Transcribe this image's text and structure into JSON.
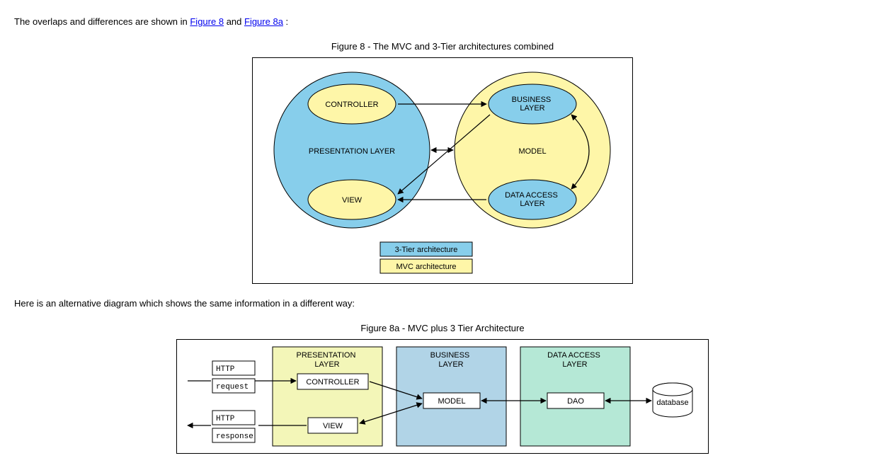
{
  "intro": {
    "pre": "The overlaps and differences are shown in ",
    "link1": "Figure 8",
    "mid": " and ",
    "link2": "Figure 8a",
    "post": ":"
  },
  "fig8": {
    "caption": "Figure 8 - The MVC and 3-Tier architectures combined",
    "presentation_layer": "PRESENTATION LAYER",
    "controller": "CONTROLLER",
    "view": "VIEW",
    "model": "MODEL",
    "business_layer": "BUSINESS LAYER",
    "data_access_layer": "DATA ACCESS LAYER",
    "legend_3tier": "3-Tier architecture",
    "legend_mvc": "MVC architecture"
  },
  "between": "Here is an alternative diagram which shows the same information in a different way:",
  "fig8a": {
    "caption": "Figure 8a - MVC plus 3 Tier Architecture",
    "http": "HTTP",
    "request": "request",
    "response": "response",
    "presentation_layer": "PRESENTATION LAYER",
    "controller": "CONTROLLER",
    "view": "VIEW",
    "business_layer": "BUSINESS LAYER",
    "model": "MODEL",
    "data_access_layer": "DATA ACCESS LAYER",
    "dao": "DAO",
    "database": "database"
  },
  "colors": {
    "blue": "#87CEEB",
    "yellow": "#FEF6A8",
    "green": "#B5E8D6",
    "blue2": "#B1D4E7"
  }
}
